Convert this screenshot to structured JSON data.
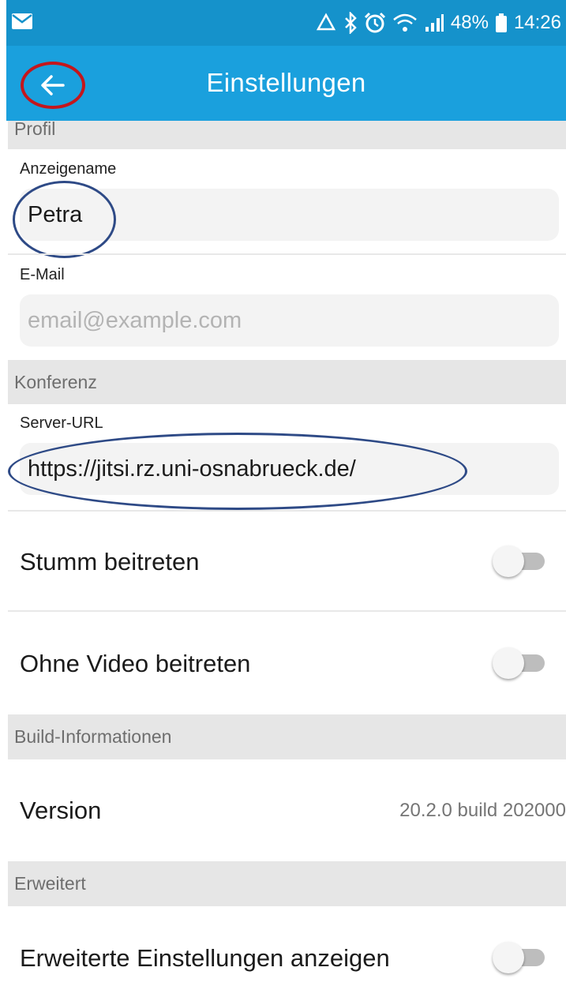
{
  "status_bar": {
    "battery_percent": "48%",
    "time": "14:26"
  },
  "app_bar": {
    "title": "Einstellungen"
  },
  "profile": {
    "header": "Profil",
    "display_name_label": "Anzeigename",
    "display_name_value": "Petra",
    "email_label": "E-Mail",
    "email_placeholder": "email@example.com"
  },
  "conference": {
    "header": "Konferenz",
    "server_url_label": "Server-URL",
    "server_url_value": "https://jitsi.rz.uni-osnabrueck.de/",
    "join_muted_label": "Stumm beitreten",
    "join_muted_on": false,
    "join_no_video_label": "Ohne Video beitreten",
    "join_no_video_on": false
  },
  "build_info": {
    "header": "Build-Informationen",
    "version_label": "Version",
    "version_value": "20.2.0 build 202000"
  },
  "advanced": {
    "header": "Erweitert",
    "show_advanced_label": "Erweiterte Einstellungen anzeigen",
    "show_advanced_on": false
  },
  "colors": {
    "status_bar": "#1592cb",
    "app_bar": "#1aa0dd",
    "annotation_red": "#c4161c",
    "annotation_blue": "#2e4a86"
  }
}
